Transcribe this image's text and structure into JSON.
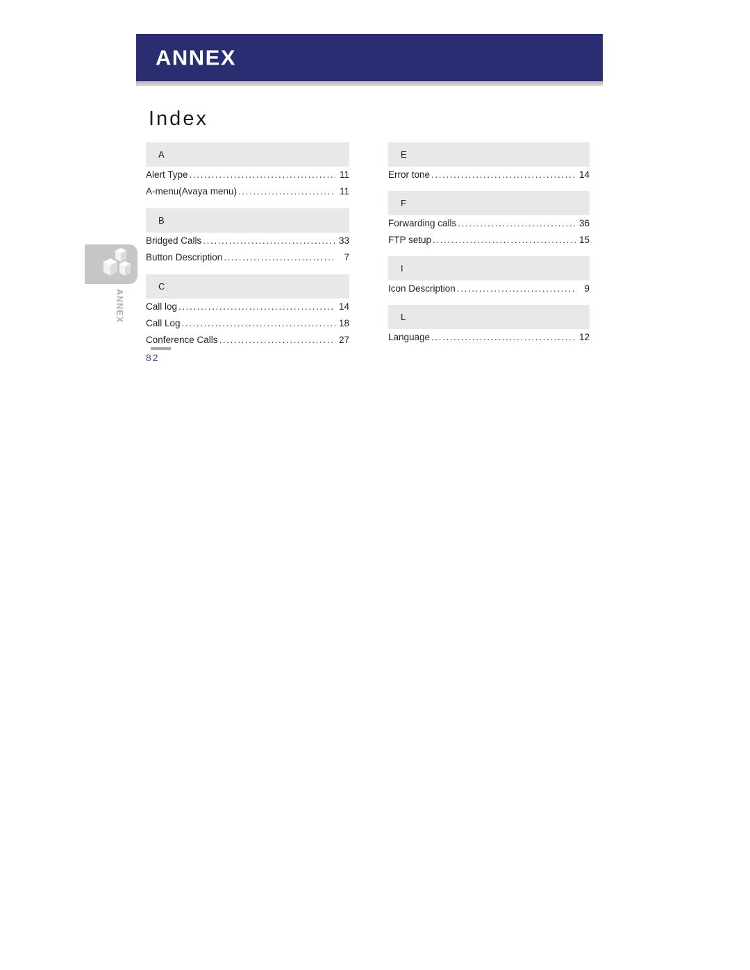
{
  "banner": {
    "chapter_title": "ANNEX"
  },
  "page_title": "Index",
  "side_tab": {
    "label": "ANNEX",
    "icon": "cubes-icon"
  },
  "page_number": "82",
  "index": {
    "left_column": [
      {
        "letter": "A",
        "entries": [
          {
            "label": "Alert Type",
            "page": "11"
          },
          {
            "label": "A-menu(Avaya menu)",
            "page": "11"
          }
        ]
      },
      {
        "letter": "B",
        "entries": [
          {
            "label": "Bridged Calls",
            "page": "33"
          },
          {
            "label": "Button Description",
            "page": "7"
          }
        ]
      },
      {
        "letter": "C",
        "entries": [
          {
            "label": "Call log",
            "page": "14"
          },
          {
            "label": "Call Log",
            "page": "18"
          },
          {
            "label": "Conference Calls",
            "page": "27"
          }
        ]
      }
    ],
    "right_column": [
      {
        "letter": "E",
        "entries": [
          {
            "label": "Error tone",
            "page": "14"
          }
        ]
      },
      {
        "letter": "F",
        "entries": [
          {
            "label": "Forwarding calls",
            "page": "36"
          },
          {
            "label": "FTP setup",
            "page": "15"
          }
        ]
      },
      {
        "letter": "I",
        "entries": [
          {
            "label": "Icon Description",
            "page": "9"
          }
        ]
      },
      {
        "letter": "L",
        "entries": [
          {
            "label": "Language",
            "page": "12"
          }
        ]
      }
    ]
  },
  "colors": {
    "banner_blue": "#2b2d72",
    "letter_box_gray": "#e8e8e8",
    "page_number_blue": "#3b4a8c",
    "side_tab_gray": "#c6c6c8",
    "side_tab_label_gray": "#a9afbd"
  }
}
